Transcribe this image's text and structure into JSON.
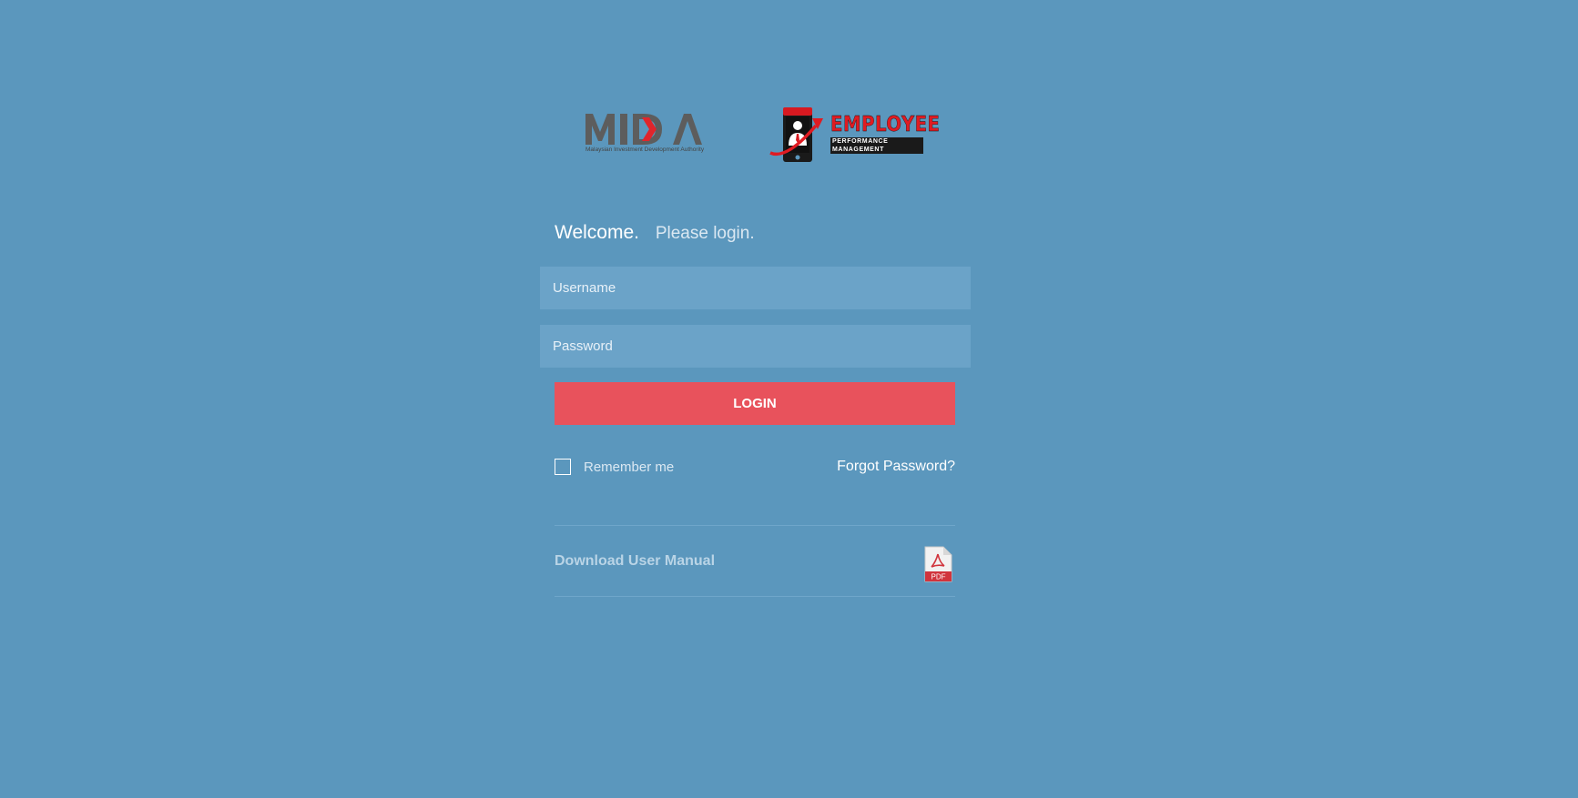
{
  "logos": {
    "mida_text": "MIDA",
    "mida_subtitle": "Malaysian Investment Development Authority",
    "epm_title": "EMPLOYEE",
    "epm_subtitle": "PERFORMANCE MANAGEMENT"
  },
  "welcome": {
    "heading": "Welcome.",
    "subheading": "Please login."
  },
  "form": {
    "username_placeholder": "Username",
    "username_value": "",
    "password_placeholder": "Password",
    "password_value": "",
    "login_label": "LOGIN",
    "remember_label": "Remember me",
    "remember_checked": false,
    "forgot_label": "Forgot Password?"
  },
  "manual": {
    "label": "Download User Manual",
    "icon": "pdf-file-icon",
    "icon_text": "PDF"
  },
  "colors": {
    "background": "#5b97bd",
    "input_bg": "#6ba3c8",
    "login_button": "#e8525c",
    "epm_red": "#e01b22"
  }
}
